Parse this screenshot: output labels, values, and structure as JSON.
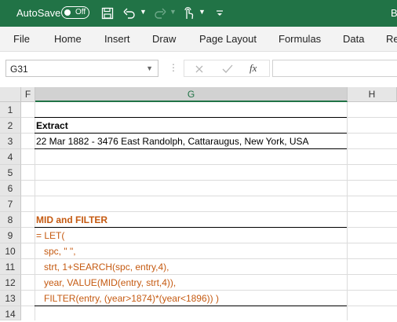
{
  "title_bar": {
    "autosave_label": "AutoSave",
    "autosave_state": "Off",
    "title_fragment": "B",
    "accent_color": "#217346"
  },
  "ribbon_tabs": [
    "File",
    "Home",
    "Insert",
    "Draw",
    "Page Layout",
    "Formulas",
    "Data",
    "Re"
  ],
  "formula_bar": {
    "name_box": "G31",
    "fx_label": "fx",
    "formula": ""
  },
  "grid": {
    "columns": [
      "F",
      "G",
      "H"
    ],
    "selected_column": "G",
    "rows": [
      "1",
      "2",
      "3",
      "4",
      "5",
      "6",
      "7",
      "8",
      "9",
      "10",
      "11",
      "12",
      "13",
      "14"
    ],
    "cells": {
      "G2": "Extract",
      "G3": "22 Mar 1882 - 3476 East Randolph, Cattaraugus, New York, USA",
      "G8": "MID and FILTER",
      "G9": "= LET(",
      "G10": "   spc, \" \",",
      "G11": "   strt, 1+SEARCH(spc, entry,4),",
      "G12": "   year, VALUE(MID(entry, strt,4)),",
      "G13": "   FILTER(entry, (year>1874)*(year<1896)) )"
    },
    "formula_color": "#c55a11"
  }
}
